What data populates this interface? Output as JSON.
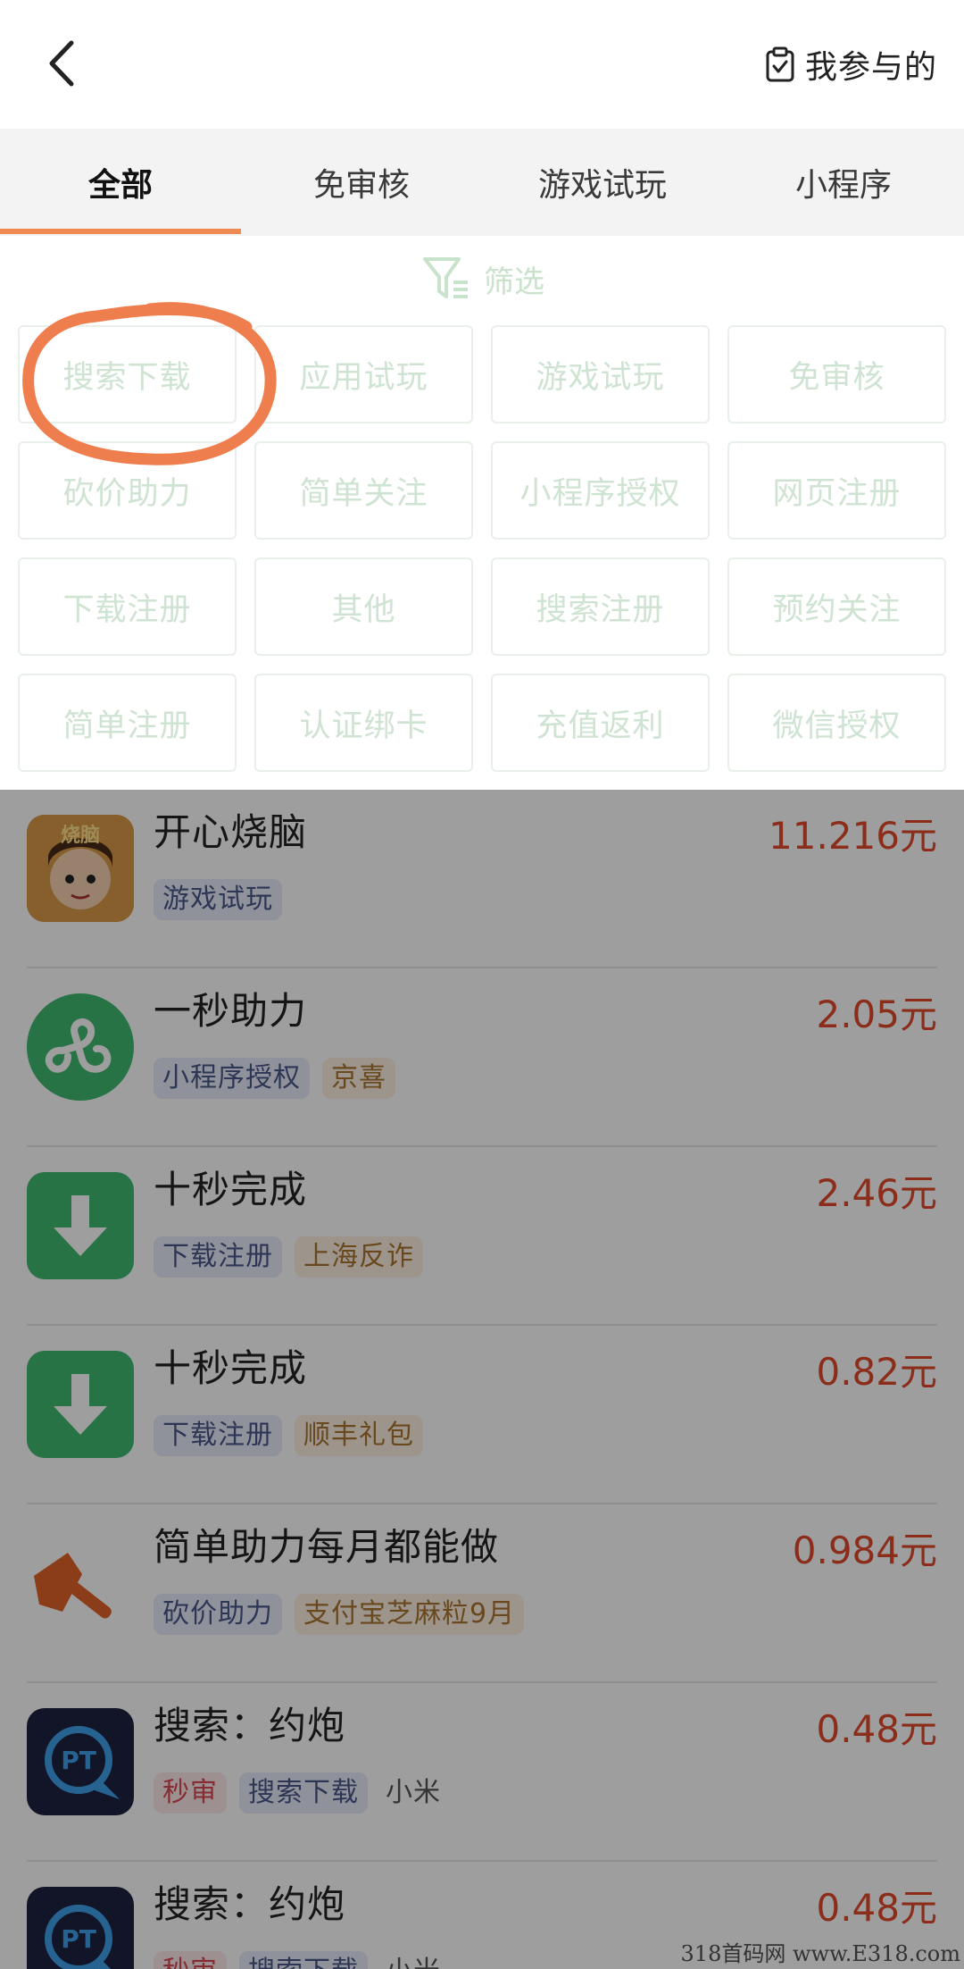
{
  "header": {
    "mine_label": "我参与的"
  },
  "tabs": [
    {
      "label": "全部",
      "active": true
    },
    {
      "label": "免审核",
      "active": false
    },
    {
      "label": "游戏试玩",
      "active": false
    },
    {
      "label": "小程序",
      "active": false
    }
  ],
  "filter": {
    "title": "筛选",
    "chips": [
      "搜索下载",
      "应用试玩",
      "游戏试玩",
      "免审核",
      "砍价助力",
      "简单关注",
      "小程序授权",
      "网页注册",
      "下载注册",
      "其他",
      "搜索注册",
      "预约关注",
      "简单注册",
      "认证绑卡",
      "充值返利",
      "微信授权"
    ]
  },
  "tasks": [
    {
      "name": "开心烧脑",
      "price": "11.216元",
      "icon": "game-avatar-icon",
      "icon_text": "烧脑",
      "tags": [
        {
          "text": "游戏试玩",
          "kind": "type"
        }
      ]
    },
    {
      "name": "一秒助力",
      "price": "2.05元",
      "icon": "mini-program-icon",
      "tags": [
        {
          "text": "小程序授权",
          "kind": "type"
        },
        {
          "text": "京喜",
          "kind": "brand"
        }
      ]
    },
    {
      "name": "十秒完成",
      "price": "2.46元",
      "icon": "download-icon",
      "tags": [
        {
          "text": "下载注册",
          "kind": "type"
        },
        {
          "text": "上海反诈",
          "kind": "brand"
        }
      ]
    },
    {
      "name": "十秒完成",
      "price": "0.82元",
      "icon": "download-icon",
      "tags": [
        {
          "text": "下载注册",
          "kind": "type"
        },
        {
          "text": "顺丰礼包",
          "kind": "brand"
        }
      ]
    },
    {
      "name": "简单助力每月都能做",
      "price": "0.984元",
      "icon": "axe-icon",
      "tags": [
        {
          "text": "砍价助力",
          "kind": "type"
        },
        {
          "text": "支付宝芝麻粒9月",
          "kind": "brand"
        }
      ]
    },
    {
      "name": "搜索：约炮",
      "price": "0.48元",
      "icon": "pt-chat-icon",
      "icon_text": "PT",
      "tags": [
        {
          "text": "秒审",
          "kind": "fast"
        },
        {
          "text": "搜索下载",
          "kind": "type"
        },
        {
          "text": "小米",
          "kind": "plain"
        }
      ]
    },
    {
      "name": "搜索：约炮",
      "price": "0.48元",
      "icon": "pt-chat-icon",
      "icon_text": "PT",
      "tags": [
        {
          "text": "秒审",
          "kind": "fast"
        },
        {
          "text": "搜索下载",
          "kind": "type"
        },
        {
          "text": "小米",
          "kind": "plain"
        }
      ]
    }
  ],
  "watermark": "318首码网 www.E318.com",
  "colors": {
    "accent": "#ee8a52",
    "price": "#e04a2a",
    "green": "#3fba72",
    "filter_text": "#cfe3d2"
  }
}
